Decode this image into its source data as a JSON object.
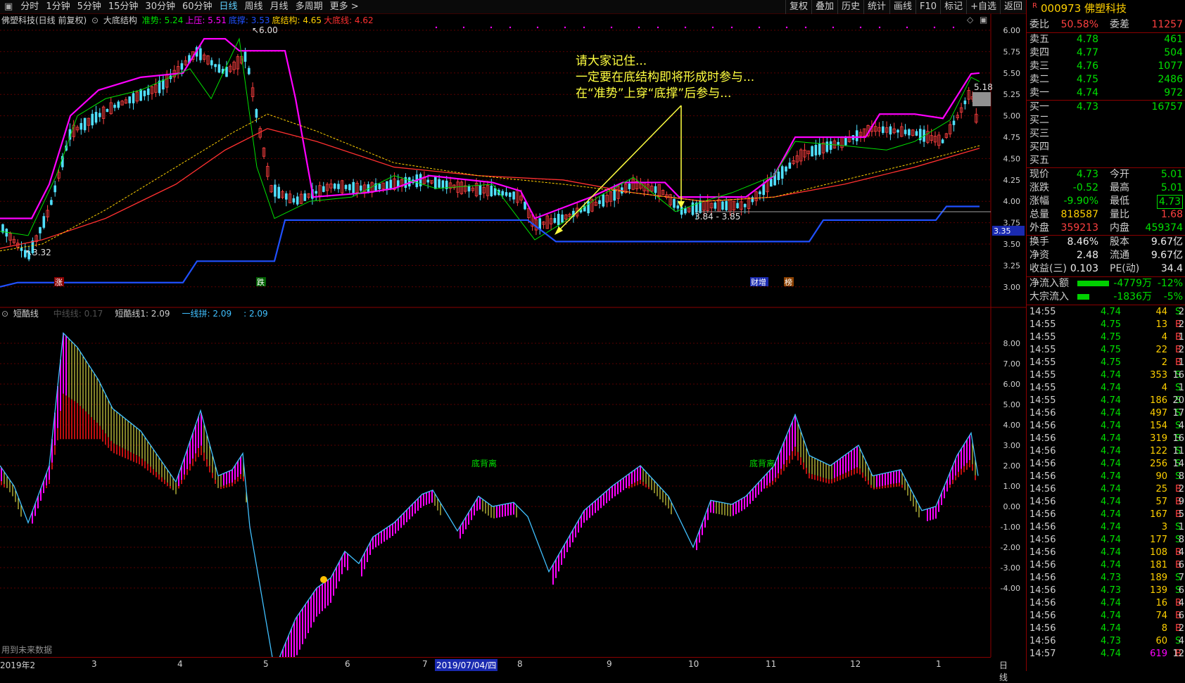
{
  "toolbar": {
    "periods": [
      "分时",
      "1分钟",
      "5分钟",
      "15分钟",
      "30分钟",
      "60分钟",
      "日线",
      "周线",
      "月线",
      "多周期",
      "更多 >"
    ],
    "active_period": "日线",
    "tools": [
      "复权",
      "叠加",
      "历史",
      "统计",
      "画线",
      "F10",
      "标记",
      "+自选",
      "返回"
    ]
  },
  "stock": {
    "code": "000973",
    "name": "佛塑科技",
    "flag": "R"
  },
  "main_legend": {
    "title": "佛塑科技(日线 前复权)",
    "indicator": "大底结构",
    "items": [
      {
        "label": "准势: 5.24",
        "color": "#00e000"
      },
      {
        "label": "上压: 5.51",
        "color": "#ff00ff"
      },
      {
        "label": "底撑: 3.53",
        "color": "#2050ff"
      },
      {
        "label": "底结构: 4.65",
        "color": "#ffd000"
      },
      {
        "label": "大底线: 4.62",
        "color": "#ff3030"
      }
    ]
  },
  "sub_legend": {
    "indicator": "短酷线",
    "items": [
      {
        "label": "中线线: 0.17",
        "color": "#505050"
      },
      {
        "label": "短酷线1: 2.09",
        "color": "#d0d0d0"
      },
      {
        "label": "一线拼: 2.09",
        "color": "#40c0ff"
      },
      {
        "label": ": 2.09",
        "color": "#40c0ff"
      }
    ]
  },
  "price_axis": [
    "6.00",
    "5.75",
    "5.50",
    "5.25",
    "5.00",
    "4.75",
    "4.50",
    "4.25",
    "4.00",
    "3.75",
    "3.50",
    "3.25",
    "3.00"
  ],
  "sub_axis": [
    "8.00",
    "7.00",
    "6.00",
    "5.00",
    "4.00",
    "3.00",
    "2.00",
    "1.00",
    "0.00",
    "-1.00",
    "-2.00",
    "-3.00",
    "-4.00"
  ],
  "annotation": {
    "lines": [
      "请大家记住...",
      "一定要在底结构即将形成时参与...",
      "在“准势”上穿“底撑”后参与..."
    ],
    "color": "#ffff40"
  },
  "chart_labels": {
    "high": "6.00",
    "low": "3.32",
    "last": "5.18",
    "range": "3.84 - 3.85",
    "support_tag": "3.35",
    "rise": "涨",
    "fall": "跌",
    "fin": "财增",
    "rank": "榜",
    "div1": "底背离",
    "div2": "底背离"
  },
  "x_axis": {
    "labels": [
      "2019年2",
      "3",
      "4",
      "5",
      "6",
      "7",
      "2019/07/04/四",
      "8",
      "9",
      "10",
      "11",
      "12",
      "1"
    ],
    "period": "日线"
  },
  "status": "用到未来数据",
  "quote": {
    "weibi": "50.58%",
    "weicha": "11257",
    "sell": [
      {
        "label": "卖五",
        "price": "4.78",
        "vol": "461"
      },
      {
        "label": "卖四",
        "price": "4.77",
        "vol": "504"
      },
      {
        "label": "卖三",
        "price": "4.76",
        "vol": "1077"
      },
      {
        "label": "卖二",
        "price": "4.75",
        "vol": "2486"
      },
      {
        "label": "卖一",
        "price": "4.74",
        "vol": "972"
      }
    ],
    "buy": [
      {
        "label": "买一",
        "price": "4.73",
        "vol": "16757"
      },
      {
        "label": "买二",
        "price": "",
        "vol": ""
      },
      {
        "label": "买三",
        "price": "",
        "vol": ""
      },
      {
        "label": "买四",
        "price": "",
        "vol": ""
      },
      {
        "label": "买五",
        "price": "",
        "vol": ""
      }
    ],
    "stats": [
      {
        "l1": "现价",
        "v1": "4.73",
        "c1": "green",
        "l2": "今开",
        "v2": "5.01",
        "c2": "green"
      },
      {
        "l1": "涨跌",
        "v1": "-0.52",
        "c1": "green",
        "l2": "最高",
        "v2": "5.01",
        "c2": "green"
      },
      {
        "l1": "涨幅",
        "v1": "-9.90%",
        "c1": "green",
        "l2": "最低",
        "v2": "4.73",
        "c2": "green"
      },
      {
        "l1": "总量",
        "v1": "818587",
        "c1": "yellow",
        "l2": "量比",
        "v2": "1.68",
        "c2": "red"
      },
      {
        "l1": "外盘",
        "v1": "359213",
        "c1": "red",
        "l2": "内盘",
        "v2": "459374",
        "c2": "green"
      }
    ],
    "fund": [
      {
        "l1": "换手",
        "v1": "8.46%",
        "l2": "股本",
        "v2": "9.67亿"
      },
      {
        "l1": "净资",
        "v1": "2.48",
        "l2": "流通",
        "v2": "9.67亿"
      },
      {
        "l1": "收益(三)",
        "v1": "0.103",
        "l2": "PE(动)",
        "v2": "34.4"
      }
    ],
    "flows": [
      {
        "label": "净流入额",
        "value": "-4779万",
        "pct": "-12%",
        "bar": 0.8
      },
      {
        "label": "大宗流入",
        "value": "-1836万",
        "pct": "-5%",
        "bar": 0.3
      }
    ]
  },
  "ticks": [
    {
      "t": "14:55",
      "p": "4.74",
      "v": "44",
      "s": "S",
      "n": "2"
    },
    {
      "t": "14:55",
      "p": "4.75",
      "v": "13",
      "s": "B",
      "n": "2"
    },
    {
      "t": "14:55",
      "p": "4.75",
      "v": "4",
      "s": "B",
      "n": "1"
    },
    {
      "t": "14:55",
      "p": "4.75",
      "v": "22",
      "s": "B",
      "n": "2"
    },
    {
      "t": "14:55",
      "p": "4.75",
      "v": "2",
      "s": "B",
      "n": "1"
    },
    {
      "t": "14:55",
      "p": "4.74",
      "v": "353",
      "s": "S",
      "n": "16"
    },
    {
      "t": "14:55",
      "p": "4.74",
      "v": "4",
      "s": "S",
      "n": "1"
    },
    {
      "t": "14:55",
      "p": "4.74",
      "v": "186",
      "s": "S",
      "n": "20"
    },
    {
      "t": "14:56",
      "p": "4.74",
      "v": "497",
      "s": "S",
      "n": "17"
    },
    {
      "t": "14:56",
      "p": "4.74",
      "v": "154",
      "s": "S",
      "n": "4"
    },
    {
      "t": "14:56",
      "p": "4.74",
      "v": "319",
      "s": "S",
      "n": "16"
    },
    {
      "t": "14:56",
      "p": "4.74",
      "v": "122",
      "s": "S",
      "n": "11"
    },
    {
      "t": "14:56",
      "p": "4.74",
      "v": "256",
      "s": "S",
      "n": "14"
    },
    {
      "t": "14:56",
      "p": "4.74",
      "v": "90",
      "s": "S",
      "n": "8"
    },
    {
      "t": "14:56",
      "p": "4.74",
      "v": "25",
      "s": "B",
      "n": "2"
    },
    {
      "t": "14:56",
      "p": "4.74",
      "v": "57",
      "s": "B",
      "n": "9"
    },
    {
      "t": "14:56",
      "p": "4.74",
      "v": "167",
      "s": "B",
      "n": "5"
    },
    {
      "t": "14:56",
      "p": "4.74",
      "v": "3",
      "s": "S",
      "n": "1"
    },
    {
      "t": "14:56",
      "p": "4.74",
      "v": "177",
      "s": "S",
      "n": "8"
    },
    {
      "t": "14:56",
      "p": "4.74",
      "v": "108",
      "s": "B",
      "n": "4"
    },
    {
      "t": "14:56",
      "p": "4.74",
      "v": "181",
      "s": "B",
      "n": "6"
    },
    {
      "t": "14:56",
      "p": "4.73",
      "v": "189",
      "s": "S",
      "n": "7"
    },
    {
      "t": "14:56",
      "p": "4.73",
      "v": "139",
      "s": "S",
      "n": "6"
    },
    {
      "t": "14:56",
      "p": "4.74",
      "v": "16",
      "s": "B",
      "n": "4"
    },
    {
      "t": "14:56",
      "p": "4.74",
      "v": "74",
      "s": "B",
      "n": "6"
    },
    {
      "t": "14:56",
      "p": "4.74",
      "v": "8",
      "s": "B",
      "n": "2"
    },
    {
      "t": "14:56",
      "p": "4.73",
      "v": "60",
      "s": "S",
      "n": "4"
    },
    {
      "t": "14:57",
      "p": "4.74",
      "v": "619",
      "s": "B",
      "n": "12"
    }
  ]
}
